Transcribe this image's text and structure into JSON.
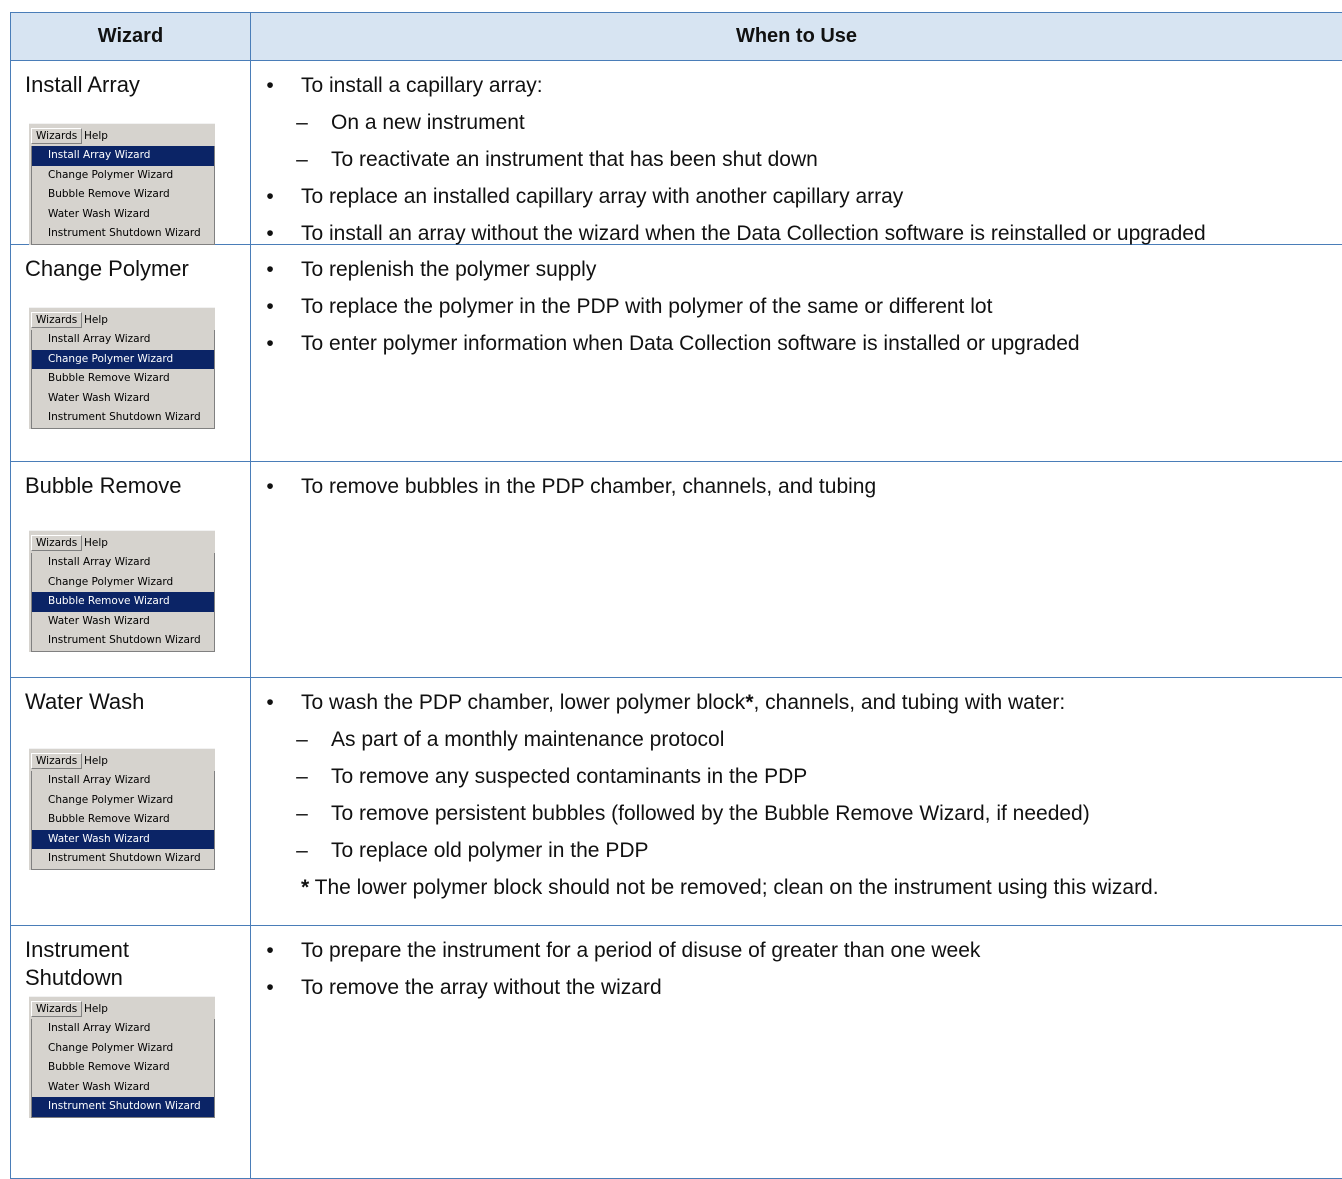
{
  "header": {
    "col1": "Wizard",
    "col2": "When to Use"
  },
  "menu": {
    "wizards": "Wizards",
    "help": "Help",
    "items": [
      "Install Array Wizard",
      "Change Polymer Wizard",
      "Bubble Remove Wizard",
      "Water Wash Wizard",
      "Instrument Shutdown Wizard"
    ]
  },
  "rows": [
    {
      "name": "Install Array",
      "selected": 0,
      "lines": [
        {
          "kind": "bullet",
          "text": "To install a capillary array:"
        },
        {
          "kind": "dash",
          "text": "On a new instrument"
        },
        {
          "kind": "dash",
          "text": "To reactivate an instrument that has been shut down"
        },
        {
          "kind": "bullet",
          "text": "To replace an installed capillary array with another capillary array"
        },
        {
          "kind": "bullet",
          "text": "To install an array without the wizard when the Data Collection software is reinstalled or upgraded"
        }
      ]
    },
    {
      "name": "Change Polymer",
      "selected": 1,
      "lines": [
        {
          "kind": "bullet",
          "text": "To replenish the polymer supply"
        },
        {
          "kind": "bullet",
          "text": "To replace the polymer in the PDP with polymer of the same or different lot"
        },
        {
          "kind": "bullet",
          "text": "To enter polymer information when Data Collection software is installed or upgraded"
        }
      ]
    },
    {
      "name": "Bubble Remove",
      "selected": 2,
      "lines": [
        {
          "kind": "bullet",
          "text": "To remove bubbles in the PDP chamber, channels, and tubing"
        }
      ]
    },
    {
      "name": "Water Wash",
      "selected": 3,
      "lines": [
        {
          "kind": "bullet",
          "text": "To wash the PDP chamber, lower polymer block*, channels, and tubing with water:"
        },
        {
          "kind": "dash",
          "text": "As part of a monthly maintenance protocol"
        },
        {
          "kind": "dash",
          "text": "To remove any suspected contaminants in the PDP"
        },
        {
          "kind": "dash",
          "text": "To remove persistent bubbles (followed by the Bubble Remove Wizard, if needed)"
        },
        {
          "kind": "dash",
          "text": "To replace old polymer in the PDP"
        },
        {
          "kind": "note",
          "text": "* The lower polymer block should not be removed; clean on the instrument using this wizard."
        }
      ]
    },
    {
      "name": "Instrument\nShutdown",
      "selected": 4,
      "lines": [
        {
          "kind": "bullet",
          "text": "To prepare the instrument for a period of disuse of greater than one week"
        },
        {
          "kind": "bullet",
          "text": "To remove the array without the wizard"
        }
      ]
    }
  ]
}
